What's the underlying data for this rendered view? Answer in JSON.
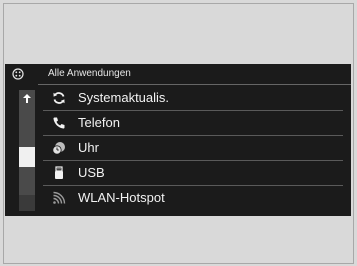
{
  "header": {
    "title": "Alle Anwendungen",
    "icon": "home-menu-icon"
  },
  "list": {
    "items": [
      {
        "label": "Systemaktualis.",
        "icon": "refresh-icon"
      },
      {
        "label": "Telefon",
        "icon": "phone-icon"
      },
      {
        "label": "Uhr",
        "icon": "clock-icon"
      },
      {
        "label": "USB",
        "icon": "usb-icon"
      },
      {
        "label": "WLAN-Hotspot",
        "icon": "wifi-icon"
      }
    ]
  },
  "scrollbar": {
    "position_fraction": 0.6,
    "up_glyph": "⇞"
  },
  "colors": {
    "background": "#d9d9d9",
    "screen": "#1b1b1b",
    "text": "#f2f2f2",
    "divider": "#5a5a5a"
  }
}
